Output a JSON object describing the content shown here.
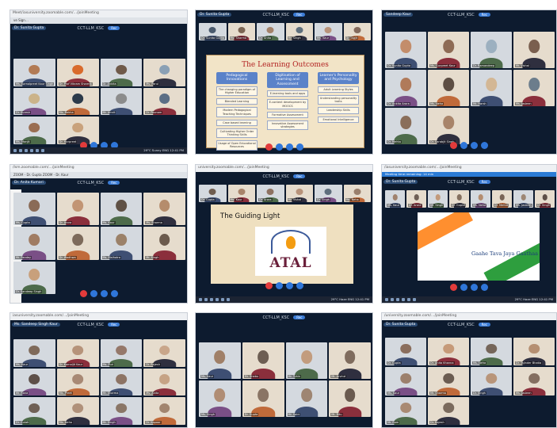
{
  "meeting_name": "CCT-LLM_KSC",
  "record_label": "Rec",
  "panels": [
    {
      "id": "p1",
      "url": "Meet/iasuniversity.zoomable.com/…/joinMeeting",
      "tab": "ve Sign…",
      "speaker": "Dr. Sunita Gupta",
      "participants": [
        "Ms. Kamalpreet Kaur Singh",
        "Dr. Prof Vikram Sharma",
        "Dr. Ankita",
        "Ms. Parul",
        "Dr. Suresh",
        "Ms. Rekha",
        "Mr. Amrit",
        "Dr. Poonam",
        "Ms. Manjit",
        "Dr. Harpreet"
      ],
      "clock": "29°C  Sunny   ENG  12:41 PM",
      "colors": [
        "#b27b55",
        "#d96b2c",
        "#6f5a4a",
        "#8aa0b5",
        "#cbb38a",
        "#2c3a4a",
        "#8c8c8c",
        "#5b6e85",
        "#9a6e52",
        "#c9a27c"
      ]
    },
    {
      "id": "p2",
      "speaker": "Dr. Sunita Gupta",
      "participants": [
        "Dr. Sunita Gupta",
        "Ms. Sharma",
        "Dr. Anita",
        "Mr. Singh",
        "Ms. Kaur",
        "Dr. Jagjit"
      ],
      "slide": {
        "title": "The Learning Outcomes",
        "columns": [
          {
            "head": "Pedagogical Innovations",
            "cells": [
              "The changing paradigm of Higher Education",
              "Blended Learning",
              "Modern Pedagogical Teaching Techniques",
              "Case based learning",
              "Cultivating Higher Order Thinking Skills",
              "Usage of Open Educational Resources"
            ]
          },
          {
            "head": "Digitisation of Learning and Assessment",
            "cells": [
              "E-learning tools and apps",
              "E-content development by MOOCS",
              "Formative Assessment",
              "Innovative Assessment strategies"
            ]
          },
          {
            "head": "Learner's Personality and Psychology",
            "cells": [
              "Adult Learning Styles",
              "Understanding personality traits",
              "Leadership Skills",
              "Emotional Intelligence"
            ]
          }
        ]
      },
      "colors": [
        "#4a5a6e",
        "#7c6553",
        "#a3826a",
        "#5f6f7d",
        "#b9937a",
        "#846a5c"
      ]
    },
    {
      "id": "p3",
      "speaker": "Sandeep Kaur",
      "participants": [
        "Dr. Sunita Gupta",
        "Ms. Gurpreet Kaur",
        "Dr. Ramandeep",
        "Mr. Vishal",
        "Dr. Ankita Arora",
        "Ms. Neha",
        "Mr. Harsh",
        "Ms. Jasleen",
        "Dr. Mehta",
        "Dr. Sarabjit Singh"
      ],
      "colors": [
        "#c38d6b",
        "#8e6b55",
        "#9cb0c0",
        "#7a5f4f",
        "#b07a5a",
        "#5d4e44",
        "#d3b795",
        "#6c7d8c",
        "#8a6e5a",
        "#a8846a"
      ]
    },
    {
      "id": "p4",
      "url": "/lsm.zoomable.com/…/joinMeeting",
      "tab": "ZOOM - Dr. Gupta   ZOOM - Dr. Kaur",
      "speaker": "Dr. Anita Kumari",
      "participants": [
        "Ms. Gupta",
        "Dr. Arora",
        "Ms. Kaur",
        "Ms. Sharma",
        "Mr. Pandey",
        "Dr. Wadhwa",
        "Ms. Malhotra",
        "Mr. Singh",
        "Dr. Sandeep Singh"
      ],
      "colors": [
        "#8a6b57",
        "#c29574",
        "#5f5145",
        "#b58c6c",
        "#a07c63",
        "#7d6a5b",
        "#9b8169",
        "#6c5b4e",
        "#c8a07c"
      ]
    },
    {
      "id": "p5",
      "url": "university.zoomable.com/…/joinMeeting",
      "participants": [
        "Dr. Gupta",
        "Ms. Kaur",
        "Dr. Arora",
        "Mr. Vishal",
        "Dr. Singh",
        "Ms. Neha"
      ],
      "slide": {
        "title": "The Guiding Light",
        "logo_text": "ATAL"
      },
      "clock": "29°C  Haze   ENG  12:41 PM",
      "colors": [
        "#6f5d50",
        "#a8836a",
        "#8d7262",
        "#b7927a",
        "#5e6e7d",
        "#9a7f6c"
      ]
    },
    {
      "id": "p6",
      "url": "/iasuniversity.zoomable.com/…/joinMeeting",
      "notice": "Meeting time remaining: 14 min",
      "speaker": "Dr. Sunita Gupta",
      "participants": [
        "Ms. Kaur",
        "Dr. Arora",
        "Mr. Singh",
        "Dr. Gupta",
        "Ms. Neha",
        "Dr. Mehta",
        "Ms. Jasleen",
        "Dr. Singh"
      ],
      "slide": {
        "caption": "Gaahe Tava Jaya Gaathaa"
      },
      "clock": "29°C  Haze   ENG  12:41 PM",
      "colors": [
        "#a0826e",
        "#6e5f55",
        "#c29a7c",
        "#85705f",
        "#b48d70",
        "#7a6556",
        "#9d8775",
        "#5d4f47"
      ]
    },
    {
      "id": "p7",
      "url": "iasuniversity.zoomable.com/…/joinMeeting",
      "speaker": "Ms. Sandeep Singh Kaur",
      "participants": [
        "Ms. Kaur",
        "Dr. Kamaljit Kaur",
        "Ms. Puri",
        "Dr. Rajesh",
        "Mr. Rana",
        "Ms. Preet",
        "Mr. Sharma",
        "Ms. Anita",
        "Dr. Gulati",
        "Ms. Neha",
        "Mr. Singh",
        "Dr. Kapoor"
      ],
      "colors": [
        "#7f6a5a",
        "#b6937a",
        "#95786a",
        "#c9a68a",
        "#5e5049",
        "#a88975",
        "#8d7465",
        "#c6a385",
        "#6f6055",
        "#b0917a",
        "#8a7667",
        "#a2856f"
      ]
    },
    {
      "id": "p8",
      "participants": [
        "Ms. Kaur",
        "Mr. Shabu",
        "Mr. Tuhin",
        "Mr. Arvind",
        "Ms. Singh",
        "Dr. Gupta",
        "Mr. Saini",
        "Mr. Ritu"
      ],
      "colors": [
        "#a08068",
        "#6d5e53",
        "#c29c7e",
        "#7f6c5e",
        "#b08d74",
        "#8a7565",
        "#9e8572",
        "#6a5a4f"
      ]
    },
    {
      "id": "p9",
      "url": "/university.zoomable.com/…/joinMeeting",
      "speaker": "Dr. Sunita Gupta",
      "participants": [
        "Dr. Gupta",
        "Dr. Anita Khanna",
        "Ms. Neha",
        "Dr. Tajinder Bhatia",
        "Ms. Kaur",
        "Mr. Sharma",
        "Dr. Singh",
        "Ms. Jasleen",
        "Mr. Ram",
        "Dr. Rajesh"
      ],
      "colors": [
        "#8a6e5d",
        "#c69a78",
        "#75665a",
        "#b58f72",
        "#9c806c",
        "#6b5c51",
        "#b8957a",
        "#846e60",
        "#a98a73",
        "#7a6a5d"
      ]
    }
  ]
}
